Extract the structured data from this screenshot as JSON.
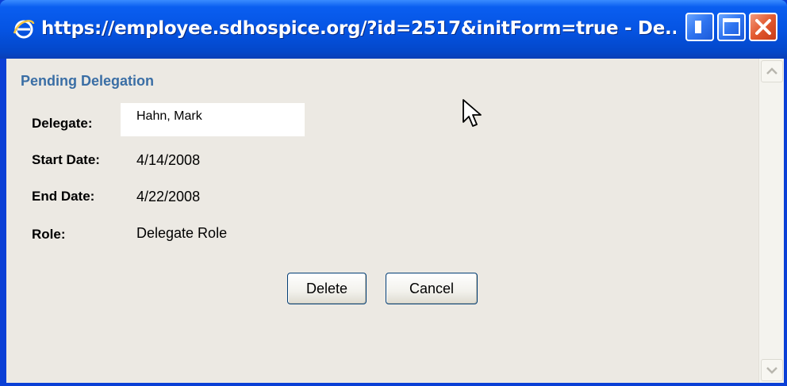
{
  "window": {
    "title": "https://employee.sdhospice.org/?id=2517&initForm=true - De...",
    "app_icon": "internet-explorer-icon",
    "controls": {
      "minimize_icon": "minimize-icon",
      "maximize_icon": "maximize-icon",
      "close_icon": "close-icon"
    }
  },
  "form": {
    "heading": "Pending Delegation",
    "fields": {
      "delegate_label": "Delegate:",
      "delegate_value": "Hahn, Mark",
      "start_label": "Start Date:",
      "start_value": "4/14/2008",
      "end_label": "End Date:",
      "end_value": "4/22/2008",
      "role_label": "Role:",
      "role_value": "Delegate Role"
    },
    "buttons": {
      "delete_label": "Delete",
      "cancel_label": "Cancel"
    }
  },
  "colors": {
    "titlebar": "#0554e3",
    "heading": "#3a6ea5",
    "content_bg": "#ece9e3",
    "close_button": "#e2592f"
  }
}
